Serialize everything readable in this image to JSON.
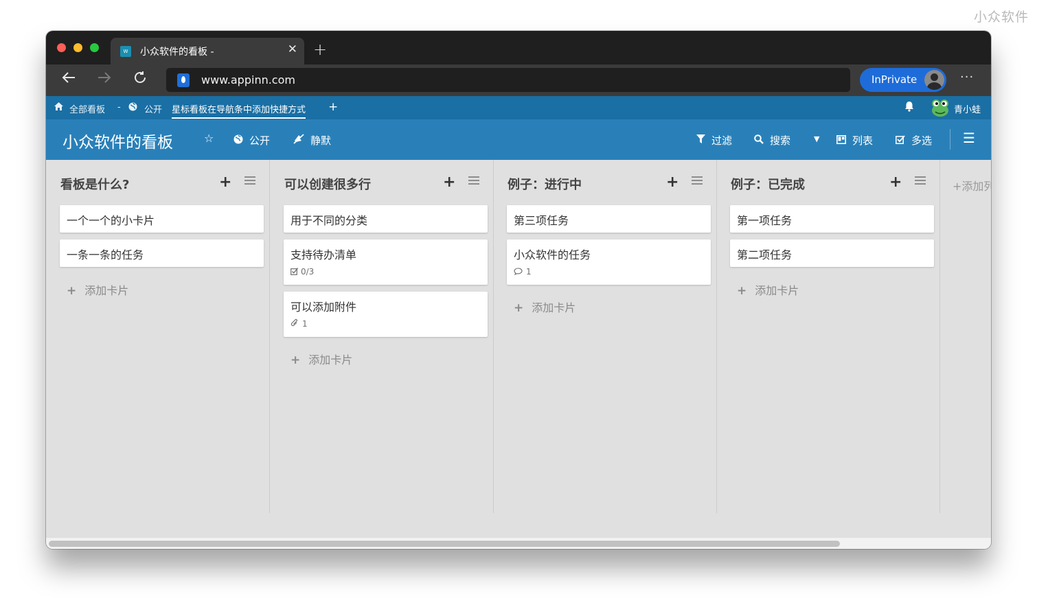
{
  "watermark": "小众软件",
  "browser": {
    "tab_title": "小众软件的看板 -",
    "tab_favicon_text": "W",
    "tab_close": "✕",
    "new_tab": "+",
    "url": "www.appinn.com",
    "inprivate_label": "InPrivate",
    "more": "···"
  },
  "breadcrumb": {
    "all_boards": "全部看板",
    "separator": "-",
    "public": "公开",
    "starred_hint": "星标看板在导航条中添加快捷方式",
    "plus": "+"
  },
  "user": {
    "name": "青小蛙"
  },
  "board_header": {
    "title": "小众软件的看板",
    "public": "公开",
    "mute": "静默",
    "filter": "过滤",
    "search": "搜索",
    "list_view": "列表",
    "multi_select": "多选"
  },
  "lists": [
    {
      "title": "看板是什么?",
      "cards": [
        {
          "text": "一个一个的小卡片"
        },
        {
          "text": "一条一条的任务"
        }
      ],
      "add_card": "添加卡片"
    },
    {
      "title": "可以创建很多行",
      "cards": [
        {
          "text": "用于不同的分类"
        },
        {
          "text": "支持待办清单",
          "badge": "0/3"
        },
        {
          "text": "可以添加附件",
          "badge": "1"
        }
      ],
      "add_card": "添加卡片"
    },
    {
      "title": "例子：进行中",
      "cards": [
        {
          "text": "第三项任务"
        },
        {
          "text": "小众软件的任务",
          "badge": "1"
        }
      ],
      "add_card": "添加卡片"
    },
    {
      "title": "例子：已完成",
      "cards": [
        {
          "text": "第一项任务"
        },
        {
          "text": "第二项任务"
        }
      ],
      "add_card": "添加卡片"
    }
  ],
  "add_list": "添加列表",
  "colors": {
    "header_blue": "#2980b9",
    "strip_blue": "#1a6fa4",
    "inprivate_blue": "#1e6cd9",
    "board_bg": "#e0e0e0"
  }
}
